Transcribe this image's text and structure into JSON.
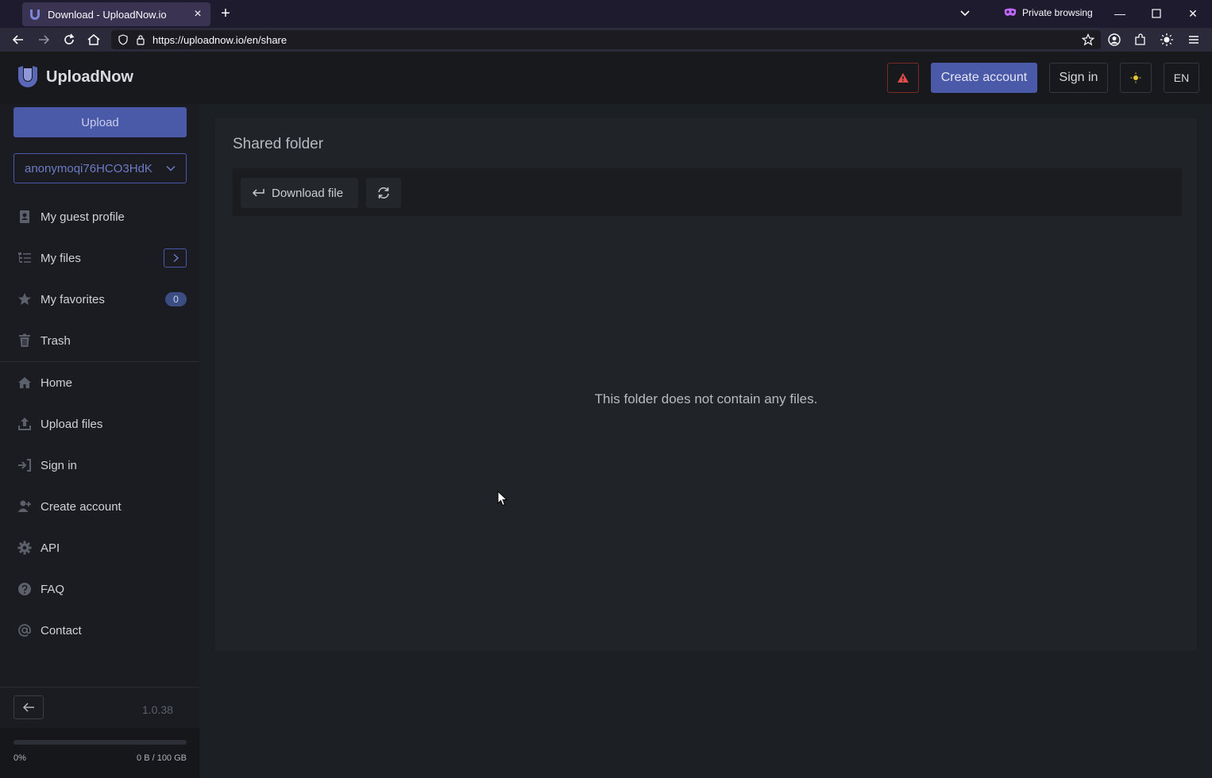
{
  "browser": {
    "tab_title": "Download - UploadNow.io",
    "private_label": "Private browsing",
    "url": "https://uploadnow.io/en/share"
  },
  "header": {
    "brand": "UploadNow",
    "create_account": "Create account",
    "sign_in": "Sign in",
    "language": "EN"
  },
  "sidebar": {
    "upload_label": "Upload",
    "account_value": "anonymoqi76HCO3HdK",
    "items": [
      {
        "label": "My guest profile",
        "icon": "profile-icon"
      },
      {
        "label": "My files",
        "icon": "files-list-icon"
      },
      {
        "label": "My favorites",
        "icon": "star-icon",
        "count": "0"
      },
      {
        "label": "Trash",
        "icon": "trash-icon"
      },
      {
        "label": "Home",
        "icon": "home-icon"
      },
      {
        "label": "Upload files",
        "icon": "upload-icon"
      },
      {
        "label": "Sign in",
        "icon": "sign-in-icon"
      },
      {
        "label": "Create account",
        "icon": "add-user-icon"
      },
      {
        "label": "API",
        "icon": "gear-icon"
      },
      {
        "label": "FAQ",
        "icon": "question-icon"
      },
      {
        "label": "Contact",
        "icon": "at-icon"
      }
    ],
    "version": "1.0.38",
    "storage_percent_label": "0%",
    "storage_fraction": 0,
    "storage_quota": "0 B / 100 GB"
  },
  "main": {
    "title": "Shared folder",
    "download_label": "Download file",
    "empty_message": "This folder does not contain any files."
  },
  "colors": {
    "accent": "#4b5aa8",
    "background": "#1c1f24",
    "alert": "#e04b4b"
  }
}
